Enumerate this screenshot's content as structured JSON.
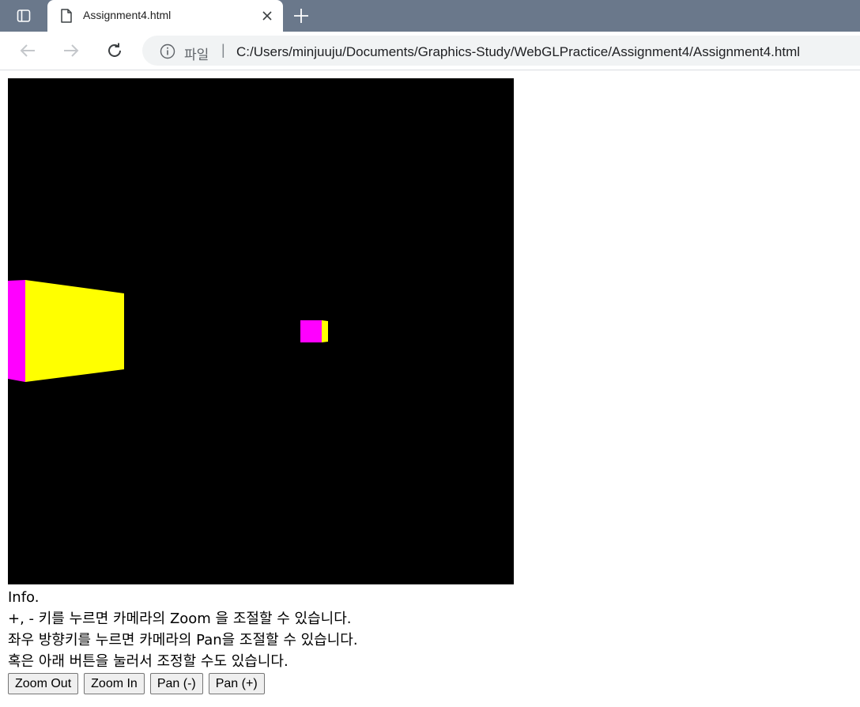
{
  "browser": {
    "tab_title": "Assignment4.html",
    "scheme_label": "파일",
    "separator": "|",
    "url": "C:/Users/minjuuju/Documents/Graphics-Study/WebGLPractice/Assignment4/Assignment4.html",
    "icons": [
      "tab-actions-icon",
      "file-icon",
      "close-icon",
      "plus-icon",
      "back-arrow-icon",
      "forward-arrow-icon",
      "reload-icon",
      "info-icon"
    ]
  },
  "scene": {
    "background": "#000000",
    "colors": {
      "front_face": "#ffff00",
      "side_face": "#ff00ff"
    }
  },
  "info": {
    "heading": "Info.",
    "line1": "+, - 키를 누르면 카메라의 Zoom 을 조절할 수 있습니다.",
    "line2": "좌우 방향키를 누르면 카메라의 Pan을 조절할 수 있습니다.",
    "line3": "혹은 아래 버튼을 눌러서 조정할 수도 있습니다."
  },
  "controls": {
    "zoom_out": "Zoom Out",
    "zoom_in": "Zoom In",
    "pan_minus": "Pan (-)",
    "pan_plus": "Pan (+)"
  }
}
